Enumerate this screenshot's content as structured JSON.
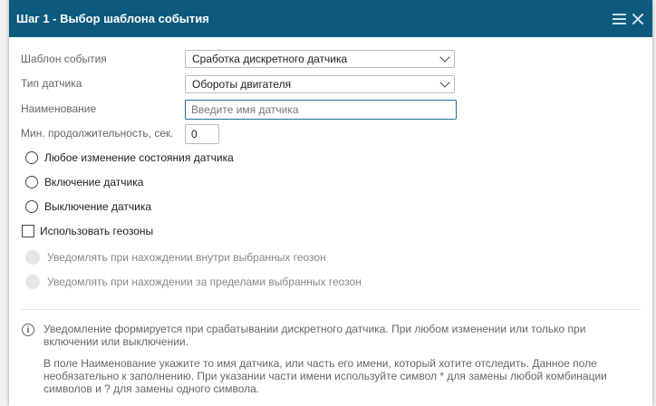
{
  "dialog": {
    "title": "Шаг 1 - Выбор шаблона события"
  },
  "form": {
    "template_label": "Шаблон события",
    "template_value": "Сработка дискретного датчика",
    "sensor_type_label": "Тип датчика",
    "sensor_type_value": "Обороты двигателя",
    "name_label": "Наименование",
    "name_placeholder": "Введите имя датчика",
    "name_value": "",
    "min_duration_label": "Мин. продолжительность, сек.",
    "min_duration_value": "0"
  },
  "options": {
    "any_change": "Любое изменение состояния датчика",
    "turn_on": "Включение датчика",
    "turn_off": "Выключение датчика",
    "use_geofences": "Использовать геозоны",
    "notify_inside": "Уведомлять при нахождении внутри выбранных геозон",
    "notify_outside": "Уведомлять при нахождении за пределами выбранных геозон"
  },
  "info": {
    "paragraph1_line1": "Уведомление формируется при срабатывании дискретного датчика. При любом изменении или только при",
    "paragraph1_line2": "включении или выключении.",
    "paragraph2_line1": "В поле Наименование укажите то имя датчика, или часть его имени, который хотите отследить. Данное поле",
    "paragraph2_line2": "необязательно к заполнению. При указании части имени используйте символ * для замены любой комбинации",
    "paragraph2_line3": "символов и ? для замены одного символа."
  },
  "colors": {
    "titlebar": "#0e5a7e",
    "focus_border": "#1f6f98"
  }
}
